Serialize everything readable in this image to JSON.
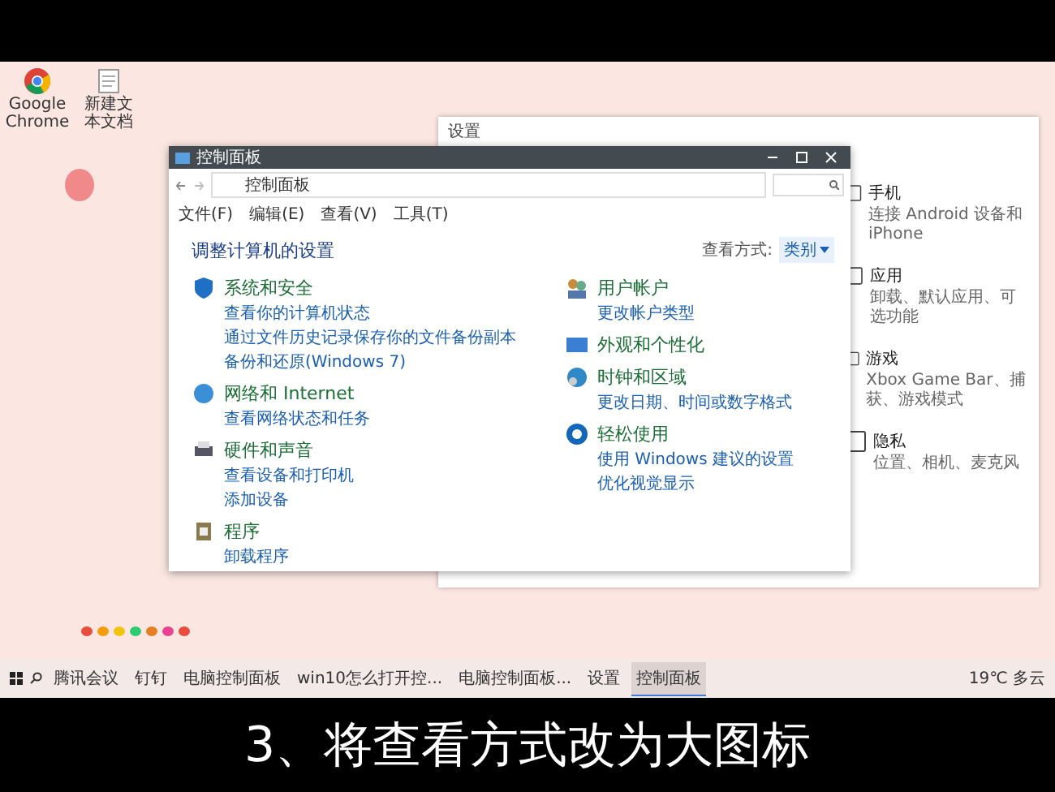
{
  "desktop_icons": [
    {
      "label": "Google Chrome",
      "kind": "browser"
    },
    {
      "label": "新建文本文档",
      "kind": "document"
    }
  ],
  "settings_window": {
    "title": "设置",
    "items": [
      {
        "title": "手机",
        "description": "连接 Android 设备和 iPhone"
      },
      {
        "title": "应用",
        "description": "卸载、默认应用、可选功能"
      },
      {
        "title": "游戏",
        "description": "Xbox Game Bar、捕获、游戏模式"
      },
      {
        "title": "隐私",
        "description": "位置、相机、麦克风"
      }
    ]
  },
  "control_panel": {
    "title": "控制面板",
    "address": "控制面板",
    "menu": [
      "文件(F)",
      "编辑(E)",
      "查看(V)",
      "工具(T)"
    ],
    "heading": "调整计算机的设置",
    "view_label": "查看方式:",
    "view_value": "类别",
    "columns": [
      [
        {
          "title": "系统和安全",
          "links": [
            "查看你的计算机状态",
            "通过文件历史记录保存你的文件备份副本",
            "备份和还原(Windows 7)"
          ]
        },
        {
          "title": "网络和 Internet",
          "links": [
            "查看网络状态和任务"
          ]
        },
        {
          "title": "硬件和声音",
          "links": [
            "查看设备和打印机",
            "添加设备"
          ]
        },
        {
          "title": "程序",
          "links": [
            "卸载程序"
          ]
        }
      ],
      [
        {
          "title": "用户帐户",
          "links": [
            "更改帐户类型"
          ]
        },
        {
          "title": "外观和个性化"
        },
        {
          "title": "时钟和区域",
          "links": [
            "更改日期、时间或数字格式"
          ]
        },
        {
          "title": "轻松使用",
          "links": [
            "使用 Windows 建议的设置",
            "优化视觉显示"
          ]
        }
      ]
    ]
  },
  "taskbar": {
    "apps": [
      {
        "label": "腾讯会议",
        "selected": false
      },
      {
        "label": "钉钉",
        "selected": false
      },
      {
        "label": "电脑控制面板",
        "selected": false
      },
      {
        "label": "win10怎么打开控...",
        "selected": false
      },
      {
        "label": "电脑控制面板...",
        "selected": false
      },
      {
        "label": "设置",
        "selected": false
      },
      {
        "label": "控制面板",
        "selected": true
      }
    ],
    "weather": "19℃ 多云"
  },
  "subtitle": "3、将查看方式改为大图标"
}
